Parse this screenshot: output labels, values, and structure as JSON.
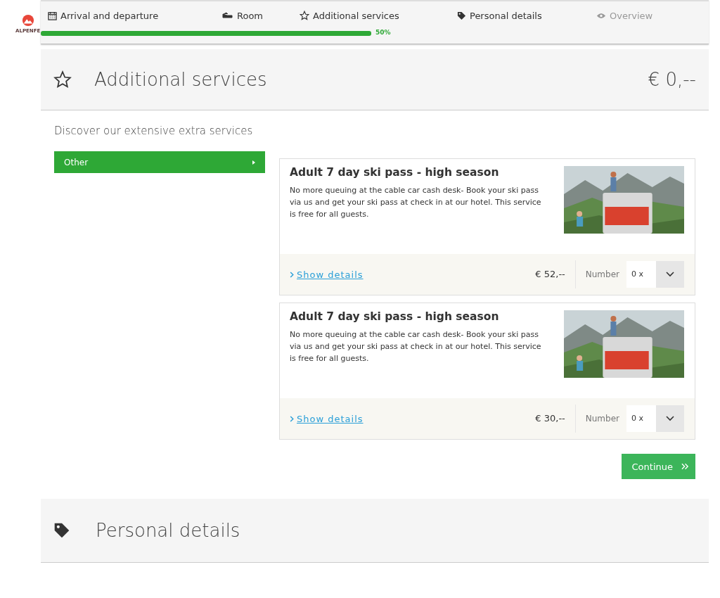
{
  "logo": {
    "text": "ALPENFE"
  },
  "steps": [
    {
      "label": "Arrival and departure",
      "kind": "calendar",
      "disabled": false
    },
    {
      "label": "Room",
      "kind": "bed",
      "disabled": false
    },
    {
      "label": "Additional services",
      "kind": "star",
      "disabled": false
    },
    {
      "label": "Personal details",
      "kind": "tag",
      "disabled": false
    },
    {
      "label": "Overview",
      "kind": "eye",
      "disabled": true
    }
  ],
  "progress": {
    "level": 0.5,
    "reading": "50%"
  },
  "section": {
    "title": "Additional services",
    "total": "€ 0,--",
    "intro": "Discover our extensive extra services"
  },
  "categories": [
    {
      "label": "Other",
      "selected": true
    }
  ],
  "services": [
    {
      "title": "Adult 7 day ski pass - high season",
      "description": "No more queuing at the cable car cash desk- Book your ski pass via us and get your ski pass at check in at our hotel. This service is free for all guests.",
      "details_link": "Show details",
      "price": "€ 52,--",
      "number_label": "Number",
      "quantity": "0 x"
    },
    {
      "title": "Adult 7 day ski pass - high season",
      "description": "No more queuing at the cable car cash desk- Book your ski pass via us and get your ski pass at check in at our hotel. This service is free for all guests.",
      "details_link": "Show details",
      "price": "€ 30,--",
      "number_label": "Number",
      "quantity": "0 x"
    }
  ],
  "continue_button": "Continue",
  "next_section": {
    "title": "Personal details"
  }
}
